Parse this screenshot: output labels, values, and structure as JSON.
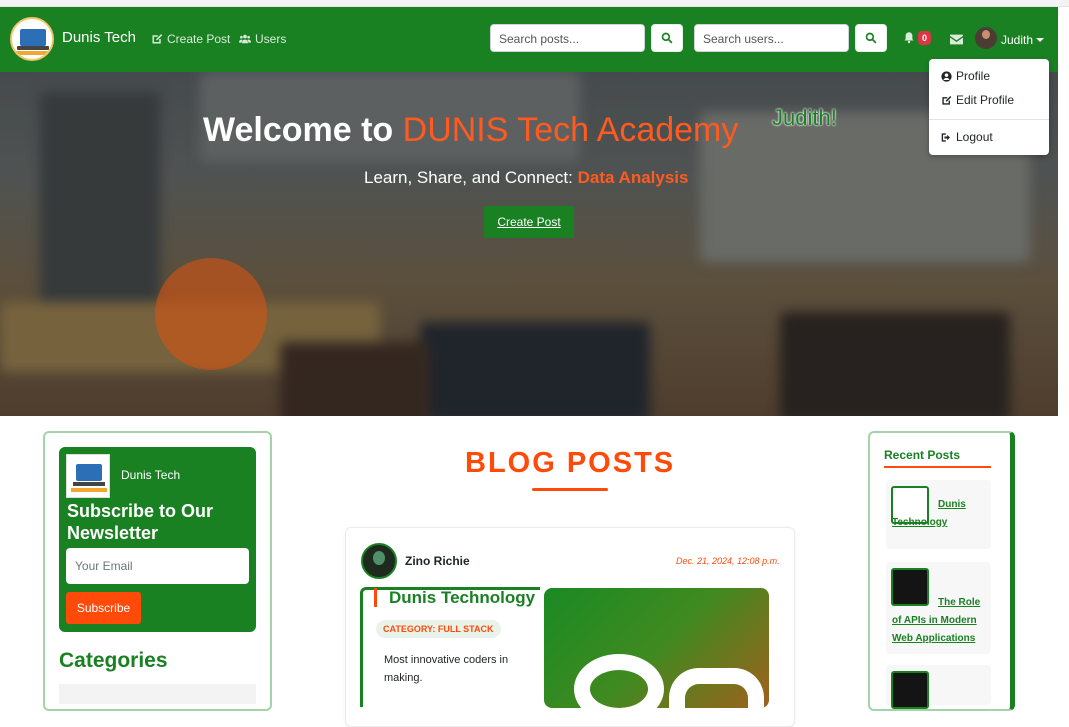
{
  "nav": {
    "brand": "Dunis Tech",
    "links": [
      {
        "label": "Create Post",
        "icon": "edit-icon"
      },
      {
        "label": "Users",
        "icon": "users-icon"
      }
    ],
    "search_posts_placeholder": "Search posts...",
    "search_users_placeholder": "Search users...",
    "notification_count": "0",
    "username": "Judith"
  },
  "user_menu": {
    "items": [
      {
        "label": "Profile",
        "icon": "user-circle-icon"
      },
      {
        "label": "Edit Profile",
        "icon": "edit-icon"
      },
      {
        "label": "Logout",
        "icon": "logout-icon"
      }
    ]
  },
  "hero": {
    "title_prefix": "Welcome to",
    "title_accent": "DUNIS Tech Academy",
    "user_greeting": "Judith!",
    "subtitle_prefix": "Learn, Share, and Connect:",
    "subtitle_accent": "Data Analysis",
    "cta_label": "Create Post"
  },
  "newsletter": {
    "brand": "Dunis Tech",
    "title": "Subscribe to Our Newsletter",
    "email_placeholder": "Your Email",
    "button_label": "Subscribe"
  },
  "categories": {
    "title": "Categories"
  },
  "blog": {
    "heading": "BLOG POSTS",
    "posts": [
      {
        "author": "Zino Richie",
        "date": "Dec. 21, 2024, 12:08 p.m.",
        "title": "Dunis Technology",
        "category": "CATEGORY: FULL STACK",
        "description": "Most innovative coders in making."
      }
    ]
  },
  "recent_posts": {
    "title": "Recent Posts",
    "items": [
      {
        "title": "Dunis Technology"
      },
      {
        "title": "The Role of APIs in Modern Web Applications"
      }
    ]
  },
  "colors": {
    "brand_green": "#1a8123",
    "accent_orange": "#ff4a0a",
    "badge_red": "#dc3545"
  }
}
